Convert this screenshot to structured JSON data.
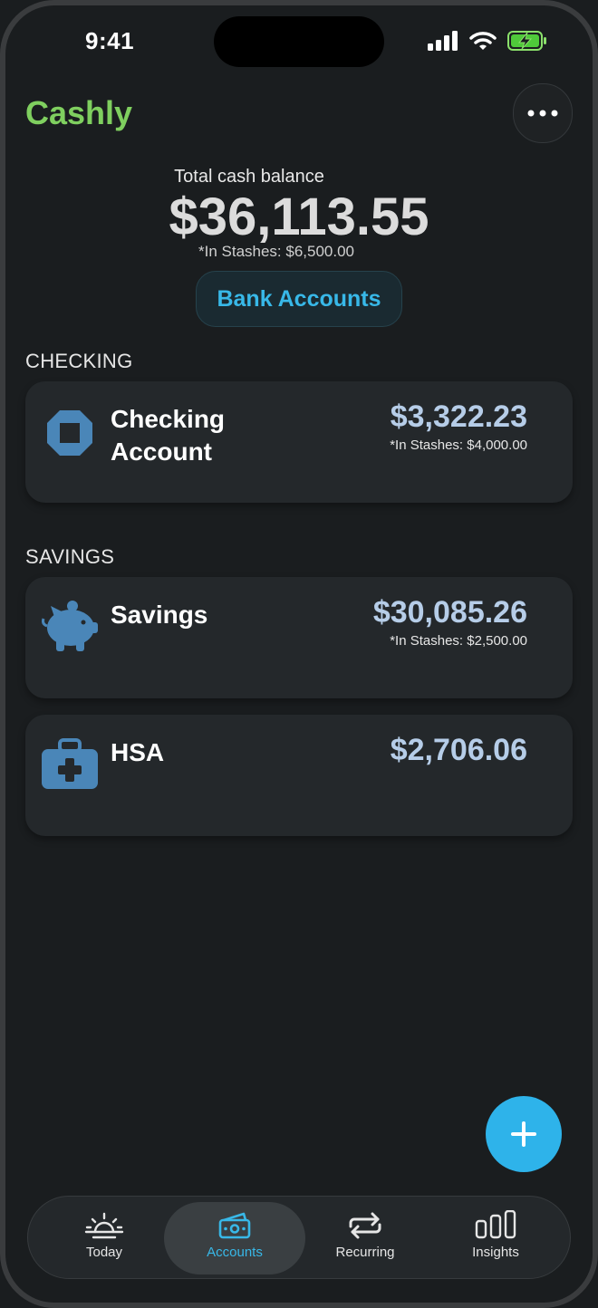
{
  "status_bar": {
    "time": "9:41"
  },
  "header": {
    "app_title": "Cashly"
  },
  "balance": {
    "label": "Total cash balance",
    "value": "$36,113.55",
    "stash": "*In Stashes: $6,500.00"
  },
  "bank_accounts_button": "Bank Accounts",
  "sections": {
    "checking": {
      "label": "CHECKING",
      "accounts": [
        {
          "name_line1": "Checking",
          "name_line2": "Account",
          "amount": "$3,322.23",
          "stash": "*In Stashes: $4,000.00",
          "icon": "bank-logo-icon"
        }
      ]
    },
    "savings": {
      "label": "SAVINGS",
      "accounts": [
        {
          "name": "Savings",
          "amount": "$30,085.26",
          "stash": "*In Stashes: $2,500.00",
          "icon": "piggy-bank-icon"
        },
        {
          "name": "HSA",
          "amount": "$2,706.06",
          "icon": "medical-kit-icon"
        }
      ]
    }
  },
  "tabs": [
    {
      "label": "Today",
      "icon": "sunrise-icon",
      "active": false
    },
    {
      "label": "Accounts",
      "icon": "cash-icon",
      "active": true
    },
    {
      "label": "Recurring",
      "icon": "repeat-icon",
      "active": false
    },
    {
      "label": "Insights",
      "icon": "bar-chart-icon",
      "active": false
    }
  ],
  "colors": {
    "brand": "#7fcf5f",
    "accent": "#38b8e8",
    "fab": "#2eb3ea",
    "amount": "#b6cde8",
    "icon_blue": "#4a86b8"
  }
}
